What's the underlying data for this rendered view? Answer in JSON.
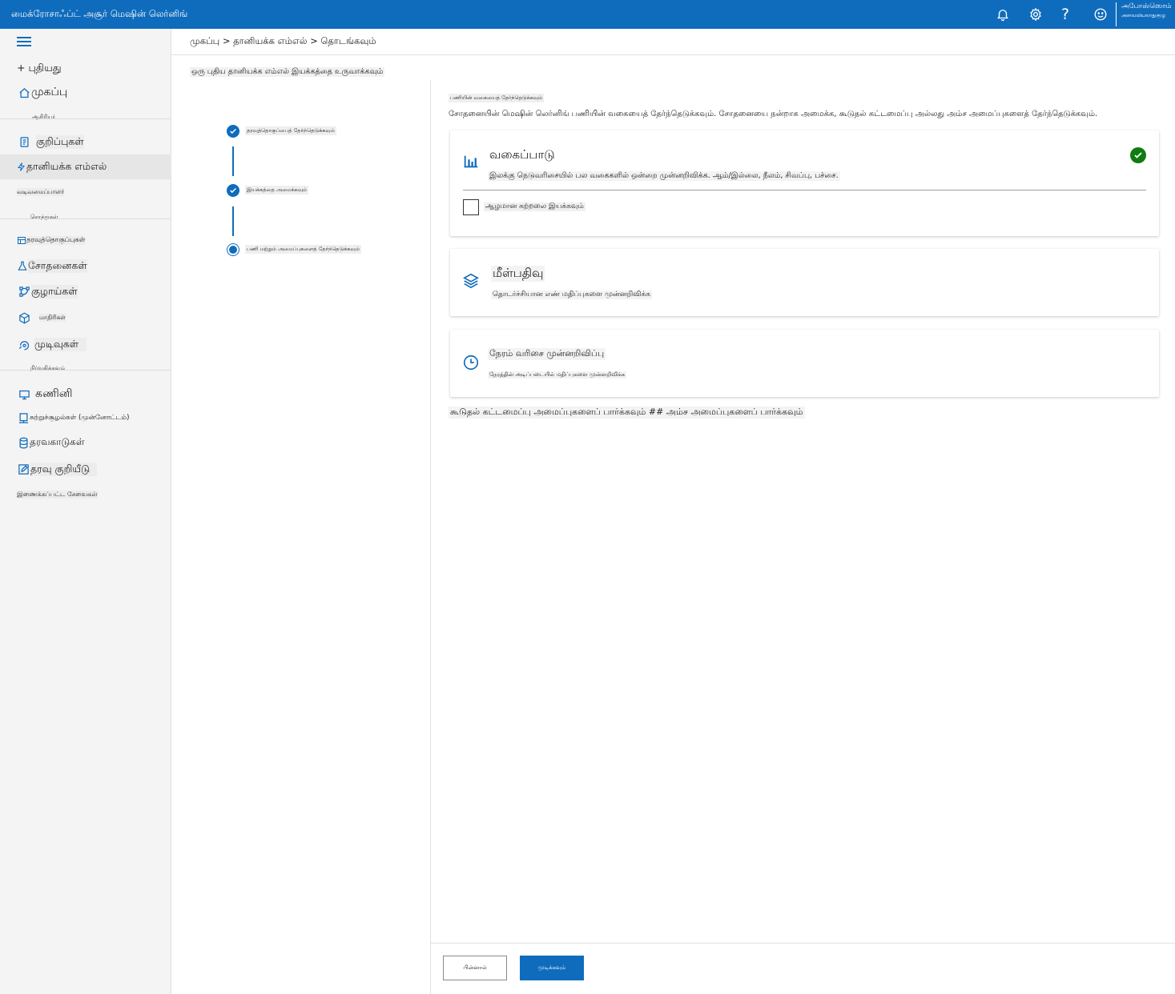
{
  "app": {
    "title": "மைக்ரோசாஃப்ட் அசூர் மெஷின் லெர்னிங்",
    "user_name": "அபோஸ்ஸொம்",
    "user_sub": "அவைவியலாதுகுழு"
  },
  "icons": {
    "notifications": "bell-icon",
    "settings": "gear-icon",
    "help": "question-icon",
    "feedback": "smiley-icon"
  },
  "sidebar": {
    "new_label": "+ புதியது",
    "home_label": "முகப்பு",
    "section_author": "ஆசிரியர்",
    "notebooks_label": "குறிப்புகள்",
    "automl_label": "தானியக்க எம்எல்",
    "designer_label": "வடிவமைப்பாளர்",
    "section_assets": "சொத்துகள்",
    "datasets_label": "தரவுத்தொகுப்புகள்",
    "experiments_label": "சோதனைகள்",
    "pipelines_label": "குழாய்கள்",
    "models_label": "மாதிரிகள்",
    "endpoints_label": "முடிவுகள்",
    "section_manage": "நிர்வகிக்கவும்",
    "compute_label": "கணினி",
    "environments_label": "சுற்றுச்சூழல்கள் (முன்னோட்டம்)",
    "datastores_label": "தரவகாடுகள்",
    "labeling_label": "தரவு குறியீடு",
    "linked_label": "இணைக்கப்பட்ட சேவைகள்"
  },
  "main": {
    "breadcrumb": "முகப்பு > தானியக்க எம்எல் > தொடங்கவும்",
    "subtitle": "ஒரு புதிய தானியக்க எம்எல் இயக்கத்தை உருவாக்கவும்"
  },
  "steps": [
    {
      "label": "தரவுத்தொகுப்பைத் தேர்ந்தெடுக்கவும்",
      "state": "done"
    },
    {
      "label": "இயக்கத்தை அமைக்கவும்",
      "state": "done"
    },
    {
      "label": "பணி மற்றும் அமைப்புகளைத் தேர்ந்தெடுக்கவும்",
      "state": "current"
    }
  ],
  "content": {
    "section_title": "பணியின் வகையைத் தேர்ந்தெடுக்கவும்",
    "section_desc": "சோதனையின் மெஷின் லெர்னிங் பணியின் வகையைத் தேர்ந்தெடுக்கவும். சோதனையை நன்றாக அமைக்க, கூடுதல் கட்டமைப்பு அல்லது அம்ச அமைப்புகளைத் தேர்ந்தெடுக்கவும்.",
    "more_links": "கூடுதல் கட்டமைப்பு அமைப்புகளைப் பார்க்கவும் ## அம்ச அமைப்புகளைப் பார்க்கவும்"
  },
  "tasks": [
    {
      "title": "வகைப்பாடு",
      "desc": "இலக்கு நெடுவரிசையில் பல வகைகளில் ஒன்றை முன்னறிவிக்க. ஆம்/இல்லை, நீலம், சிவப்பு, பச்சை.",
      "icon": "bar-chart-icon",
      "selected": true,
      "deep_learning_label": "ஆழமான கற்றலை இயக்கவும்"
    },
    {
      "title": "மீள்பதிவு",
      "desc": "தொடர்ச்சியான எண் மதிப்புகளை முன்னறிவிக்க",
      "icon": "layers-icon",
      "selected": false
    },
    {
      "title": "நேரம் வரிசை முன்னறிவிப்பு",
      "desc": "நேரத்தின் அடிப்படையில் மதிப்புகளை முன்னறிவிக்க",
      "icon": "clock-icon",
      "selected": false
    }
  ],
  "footer": {
    "back_label": "பின்னால்",
    "next_label": "முடிக்கவும்"
  },
  "colors": {
    "accent": "#0f6cbd",
    "success": "#107c10"
  }
}
